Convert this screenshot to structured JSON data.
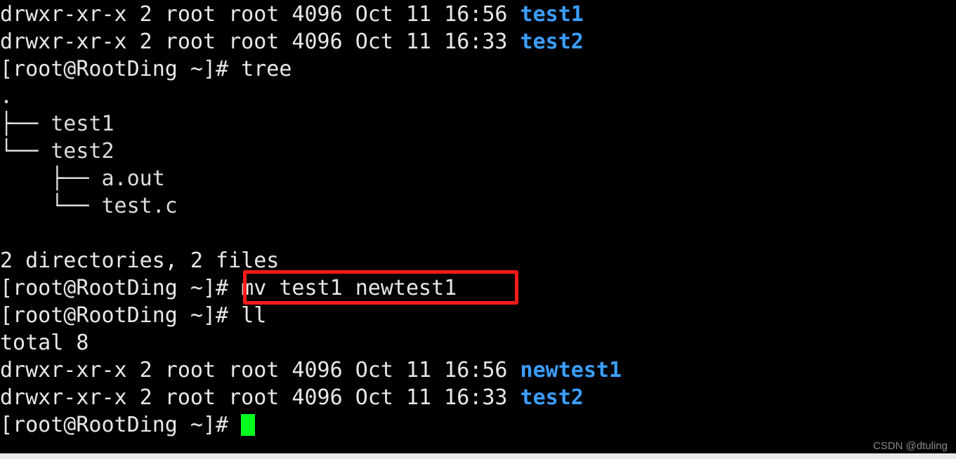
{
  "terminal": {
    "background_color": "#000000",
    "foreground_color": "#e8e8e8",
    "directory_color": "#3b9eff",
    "cursor_color": "#00ff1e",
    "lines": [
      {
        "id": "ls-test1",
        "segments": [
          {
            "text": "drwxr-xr-x 2 root root 4096 Oct 11 16:56 ",
            "style": "white"
          },
          {
            "text": "test1",
            "style": "blue"
          }
        ]
      },
      {
        "id": "ls-test2",
        "segments": [
          {
            "text": "drwxr-xr-x 2 root root 4096 Oct 11 16:33 ",
            "style": "white"
          },
          {
            "text": "test2",
            "style": "blue"
          }
        ]
      },
      {
        "id": "prompt-tree",
        "segments": [
          {
            "text": "[root@RootDing ~]# tree",
            "style": "white"
          }
        ]
      },
      {
        "id": "tree-root",
        "segments": [
          {
            "text": ".",
            "style": "tree"
          }
        ]
      },
      {
        "id": "tree-test1",
        "segments": [
          {
            "text": "├── test1",
            "style": "tree"
          }
        ]
      },
      {
        "id": "tree-test2",
        "segments": [
          {
            "text": "└── test2",
            "style": "tree"
          }
        ]
      },
      {
        "id": "tree-aout",
        "segments": [
          {
            "text": "    ├── a.out",
            "style": "tree"
          }
        ]
      },
      {
        "id": "tree-testc",
        "segments": [
          {
            "text": "    └── test.c",
            "style": "tree"
          }
        ]
      },
      {
        "id": "blank-1",
        "segments": [
          {
            "text": " ",
            "style": "white"
          }
        ]
      },
      {
        "id": "tree-summary",
        "segments": [
          {
            "text": "2 directories, 2 files",
            "style": "white"
          }
        ]
      },
      {
        "id": "prompt-mv",
        "segments": [
          {
            "text": "[root@RootDing ~]# mv test1 newtest1",
            "style": "white"
          }
        ]
      },
      {
        "id": "prompt-ll",
        "segments": [
          {
            "text": "[root@RootDing ~]# ll",
            "style": "white"
          }
        ]
      },
      {
        "id": "ll-total",
        "segments": [
          {
            "text": "total 8",
            "style": "white"
          }
        ]
      },
      {
        "id": "ls-newtest1",
        "segments": [
          {
            "text": "drwxr-xr-x 2 root root 4096 Oct 11 16:56 ",
            "style": "white"
          },
          {
            "text": "newtest1",
            "style": "blue"
          }
        ]
      },
      {
        "id": "ls-test2-after",
        "segments": [
          {
            "text": "drwxr-xr-x 2 root root 4096 Oct 11 16:33 ",
            "style": "white"
          },
          {
            "text": "test2",
            "style": "blue"
          }
        ]
      },
      {
        "id": "prompt-cursor",
        "segments": [
          {
            "text": "[root@RootDing ~]# ",
            "style": "white"
          },
          {
            "text": "",
            "style": "cursor"
          }
        ]
      }
    ]
  },
  "annotation": {
    "highlight_box": {
      "color": "#ff1a1a",
      "target_text": "mv test1 newtest1"
    }
  },
  "watermark": {
    "text": "CSDN @dtuling"
  }
}
